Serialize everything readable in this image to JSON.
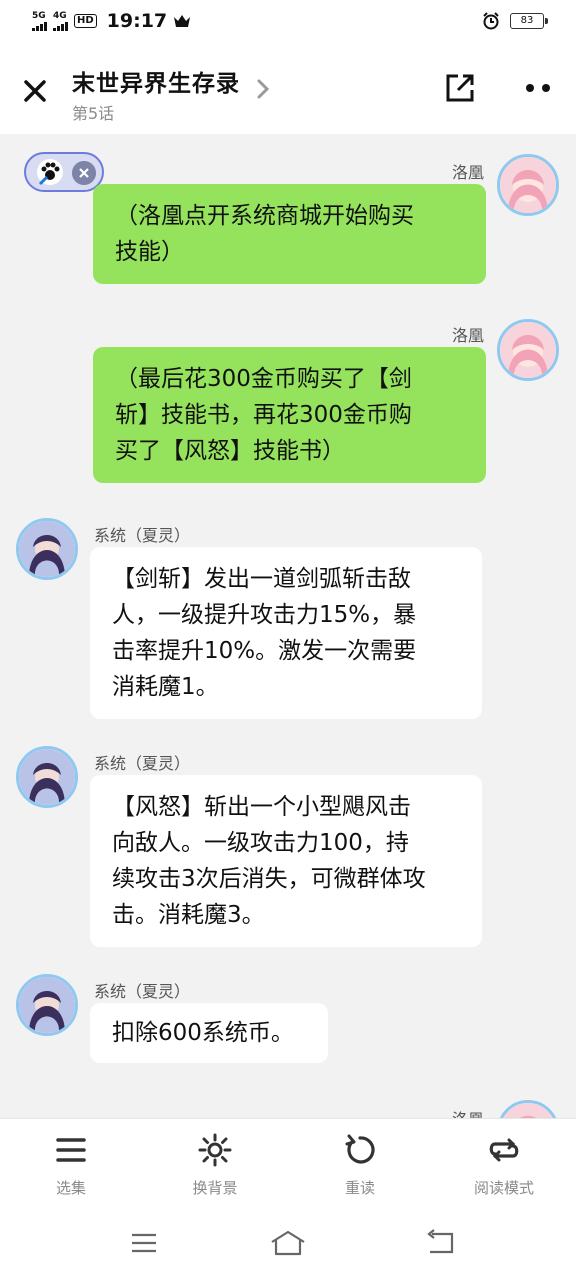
{
  "status_bar": {
    "signal1": "5G",
    "signal2": "4G",
    "hd": "HD",
    "time": "19:17",
    "battery": "83"
  },
  "header": {
    "title": "末世异界生存录",
    "subtitle": "第5话"
  },
  "messages": [
    {
      "side": "right",
      "name": "洛凰",
      "text_lines": [
        "（洛凰点开系统商城开始购买",
        "技能）"
      ]
    },
    {
      "side": "right",
      "name": "洛凰",
      "text_lines": [
        "（最后花300金币购买了【剑",
        "斩】技能书，再花300金币购",
        "买了【风怒】技能书）"
      ]
    },
    {
      "side": "left",
      "name": "系统（夏灵）",
      "text_lines": [
        "【剑斩】发出一道剑弧斩击敌",
        "人，一级提升攻击力15%，暴",
        "击率提升10%。激发一次需要",
        "消耗魔1。"
      ]
    },
    {
      "side": "left",
      "name": "系统（夏灵）",
      "text_lines": [
        "【风怒】斩出一个小型飓风击",
        "向敌人。一级攻击力100，持",
        "续攻击3次后消失，可微群体攻",
        "击。消耗魔3。"
      ]
    },
    {
      "side": "left",
      "name": "系统（夏灵）",
      "text_lines": [
        "扣除600系统币。"
      ]
    },
    {
      "side": "right",
      "name": "洛凰",
      "text_lines": []
    }
  ],
  "bottom_tabs": [
    {
      "label": "选集",
      "icon": "menu-icon"
    },
    {
      "label": "换背景",
      "icon": "sun-icon"
    },
    {
      "label": "重读",
      "icon": "reload-icon"
    },
    {
      "label": "阅读模式",
      "icon": "loop-icon"
    }
  ],
  "colors": {
    "green_bubble": "#95e35c",
    "white_bubble": "#ffffff",
    "background": "#f2f2f2",
    "avatar_border": "#8fc9ef"
  }
}
